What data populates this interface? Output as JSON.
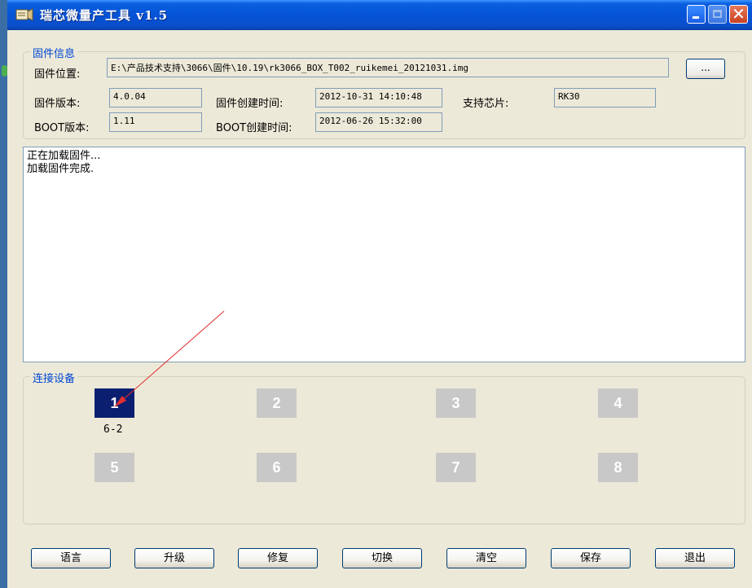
{
  "window": {
    "title": "瑞芯微量产工具 v1.5"
  },
  "firmware_info": {
    "legend": "固件信息",
    "location_label": "固件位置:",
    "location_value": "E:\\产品技术支持\\3066\\固件\\10.19\\rk3066_BOX_T002_ruikemei_20121031.img",
    "browse_label": "...",
    "version_label": "固件版本:",
    "version_value": "4.0.04",
    "created_label": "固件创建时间:",
    "created_value": "2012-10-31 14:10:48",
    "chip_label": "支持芯片:",
    "chip_value": "RK30",
    "boot_version_label": "BOOT版本:",
    "boot_version_value": "1.11",
    "boot_created_label": "BOOT创建时间:",
    "boot_created_value": "2012-06-26 15:32:00"
  },
  "log": {
    "lines": [
      "正在加载固件...",
      "加载固件完成."
    ]
  },
  "devices": {
    "legend": "连接设备",
    "slots": [
      {
        "label": "1",
        "sub": "6-2",
        "active": true
      },
      {
        "label": "2",
        "sub": "",
        "active": false
      },
      {
        "label": "3",
        "sub": "",
        "active": false
      },
      {
        "label": "4",
        "sub": "",
        "active": false
      },
      {
        "label": "5",
        "sub": "",
        "active": false
      },
      {
        "label": "6",
        "sub": "",
        "active": false
      },
      {
        "label": "7",
        "sub": "",
        "active": false
      },
      {
        "label": "8",
        "sub": "",
        "active": false
      }
    ]
  },
  "buttons": {
    "language": "语言",
    "upgrade": "升级",
    "repair": "修复",
    "switch": "切换",
    "clear": "清空",
    "save": "保存",
    "exit": "退出"
  },
  "colors": {
    "active_device": "#0b1f70",
    "inactive_device": "#c8c8c8",
    "legend_text": "#0046d5",
    "annotation_arrow": "#e03030"
  },
  "icons": {
    "app": "app-icon",
    "minimize": "minimize-icon",
    "maximize": "maximize-icon",
    "close": "close-icon"
  }
}
